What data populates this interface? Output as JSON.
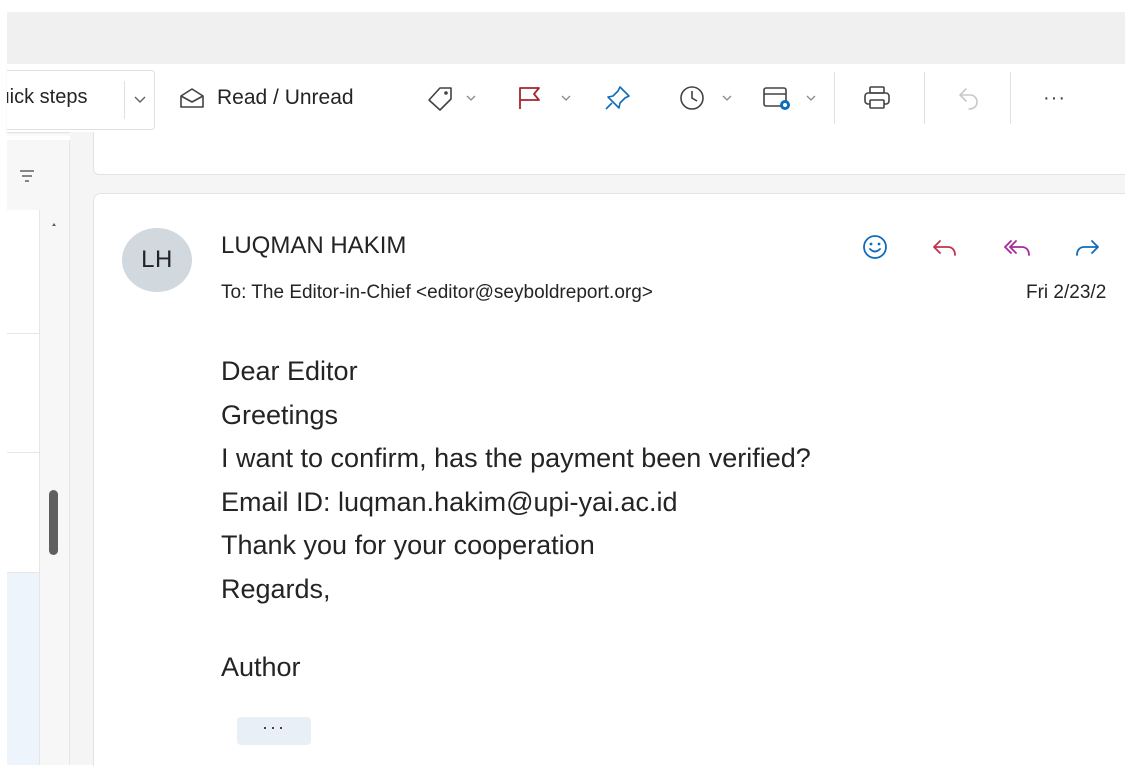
{
  "toolbar": {
    "quick_steps_label": "Quick steps",
    "read_unread_label": "Read / Unread",
    "more_label": "···"
  },
  "message": {
    "sender_initials": "LH",
    "sender_name": "LUQMAN HAKIM",
    "to_prefix": "To:",
    "to_recipient": "The Editor-in-Chief <editor@seyboldreport.org>",
    "date": "Fri 2/23/2",
    "body_lines": [
      "Dear Editor",
      "Greetings",
      "I want to confirm, has the payment been verified?",
      "Email ID: luqman.hakim@upi-yai.ac.id",
      "Thank you for your cooperation",
      "Regards,"
    ],
    "signature": "Author",
    "show_more_label": "···"
  },
  "colors": {
    "flag": "#a4262c",
    "pin": "#0f6cbd",
    "accent_blue": "#0f6cbd",
    "reply_red": "#c4314b",
    "reply_all_purple": "#a8299b",
    "forward_blue": "#0f6cbd",
    "avatar_bg": "#d1d8de"
  },
  "icons": [
    "filter-icon",
    "envelope-open-icon",
    "tag-icon",
    "flag-icon",
    "pin-icon",
    "clock-icon",
    "rules-icon",
    "printer-icon",
    "undo-icon",
    "more-icon",
    "emoji-icon",
    "reply-icon",
    "reply-all-icon",
    "forward-icon"
  ]
}
